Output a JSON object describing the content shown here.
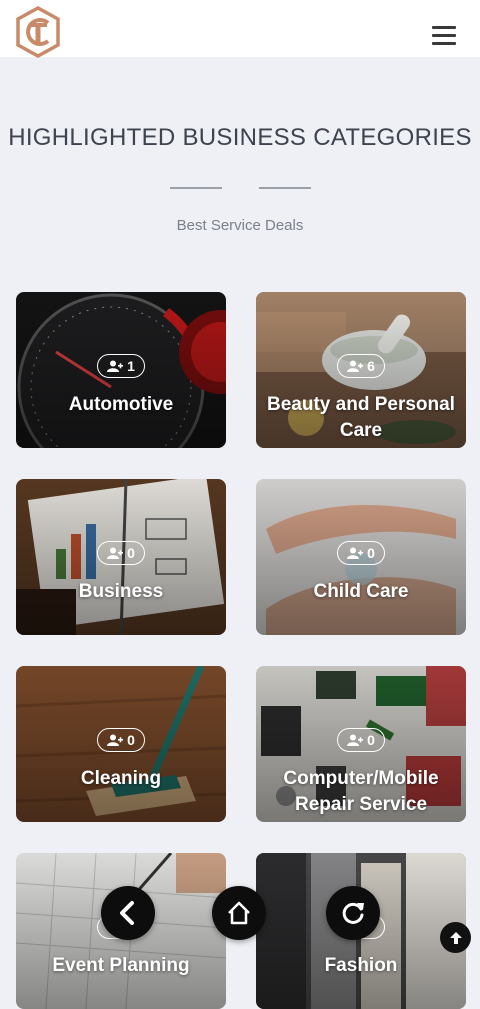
{
  "header": {
    "logo_icon": "tc-logo-icon",
    "menu_icon": "hamburger-menu-icon"
  },
  "section": {
    "title": "HIGHLIGHTED BUSINESS CATEGORIES",
    "subtitle": "Best Service Deals"
  },
  "categories": [
    {
      "name": "Automotive",
      "count": "1"
    },
    {
      "name": "Beauty and Personal Care",
      "count": "6"
    },
    {
      "name": "Business",
      "count": "0"
    },
    {
      "name": "Child Care",
      "count": "0"
    },
    {
      "name": "Cleaning",
      "count": "0"
    },
    {
      "name": "Computer/Mobile Repair Service",
      "count": "0"
    },
    {
      "name": "Event Planning",
      "count": ""
    },
    {
      "name": "Fashion",
      "count": ""
    }
  ],
  "nav": {
    "back_icon": "chevron-left-icon",
    "home_icon": "home-icon",
    "refresh_icon": "refresh-icon",
    "scroll_top_icon": "arrow-up-icon"
  },
  "colors": {
    "logo": "#c98a6a",
    "fab": "#0d0d0d",
    "page_bg": "#eef0f5"
  }
}
